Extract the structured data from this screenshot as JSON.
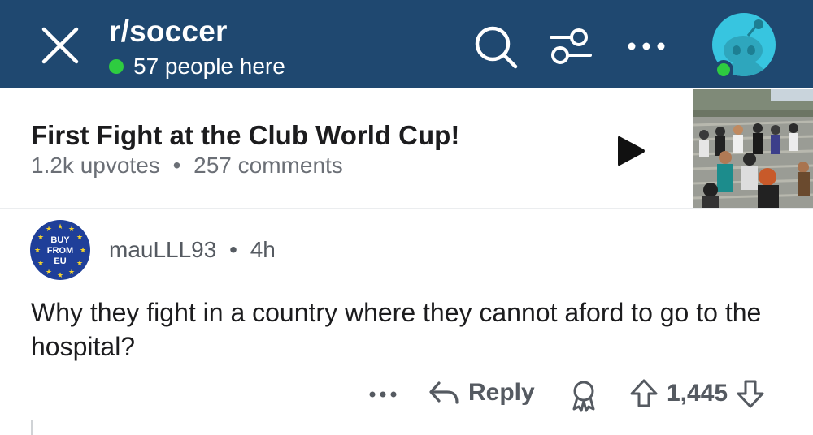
{
  "header": {
    "subreddit": "r/soccer",
    "online_text": "57 people here",
    "colors": {
      "background": "#1f4870",
      "online_dot": "#2ecc40",
      "avatar": "#37c5e0"
    },
    "icons": [
      "close-icon",
      "search-icon",
      "filter-icon",
      "more-icon",
      "user-avatar"
    ]
  },
  "post": {
    "title": "First Fight at the Club World Cup!",
    "upvotes": "1.2k upvotes",
    "separator": "•",
    "comments": "257 comments",
    "icons": [
      "play-icon"
    ]
  },
  "comment": {
    "author": "mauLLL93",
    "separator": "•",
    "age": "4h",
    "badge_lines": [
      "BUY",
      "FROM",
      "EU"
    ],
    "body": "Why they fight in a country where they cannot aford to go to the hospital?",
    "actions": {
      "reply_label": "Reply",
      "score": "1,445",
      "icons": [
        "more-icon",
        "reply-icon",
        "award-icon",
        "upvote-icon",
        "downvote-icon"
      ]
    }
  }
}
